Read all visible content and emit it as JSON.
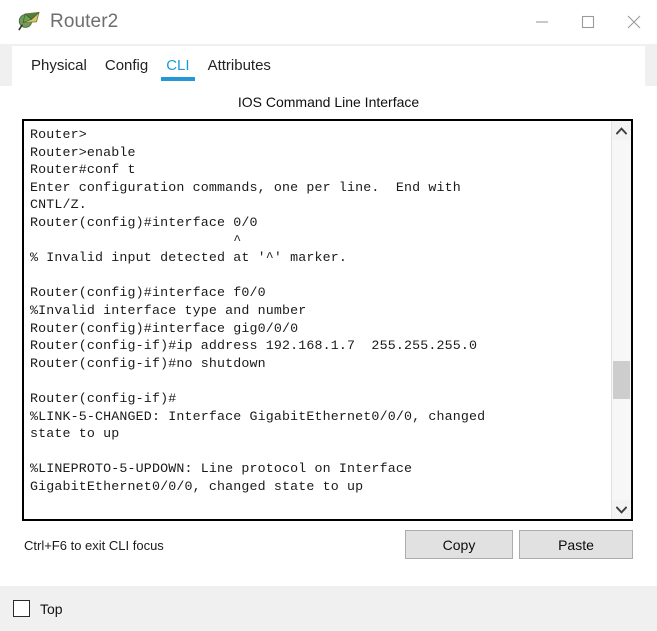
{
  "window": {
    "title": "Router2",
    "icon": "packet-tracer-router-icon",
    "controls": {
      "minimize": "minimize-icon",
      "maximize": "maximize-icon",
      "close": "close-icon"
    }
  },
  "tabs": [
    {
      "label": "Physical",
      "active": false
    },
    {
      "label": "Config",
      "active": false
    },
    {
      "label": "CLI",
      "active": true
    },
    {
      "label": "Attributes",
      "active": false
    }
  ],
  "cli": {
    "heading": "IOS Command Line Interface",
    "output": "Router>\nRouter>enable\nRouter#conf t\nEnter configuration commands, one per line.  End with\nCNTL/Z.\nRouter(config)#interface 0/0\n                         ^\n% Invalid input detected at '^' marker.\n\nRouter(config)#interface f0/0\n%Invalid interface type and number\nRouter(config)#interface gig0/0/0\nRouter(config-if)#ip address 192.168.1.7  255.255.255.0\nRouter(config-if)#no shutdown\n\nRouter(config-if)#\n%LINK-5-CHANGED: Interface GigabitEthernet0/0/0, changed\nstate to up\n\n%LINEPROTO-5-UPDOWN: Line protocol on Interface\nGigabitEthernet0/0/0, changed state to up",
    "scrollbar": {
      "up_arrow": "chevron-up-icon",
      "down_arrow": "chevron-down-icon"
    }
  },
  "footer": {
    "hint": "Ctrl+F6 to exit CLI focus",
    "copy_label": "Copy",
    "paste_label": "Paste"
  },
  "bottom": {
    "top_label": "Top",
    "top_checked": false
  },
  "colors": {
    "accent": "#2398d4",
    "tab_active_text": "#1e9bd7",
    "chrome": "#f0f0f0",
    "panel": "#ffffff",
    "terminal_text": "#1a1a1a",
    "button_face": "#e1e1e1"
  }
}
